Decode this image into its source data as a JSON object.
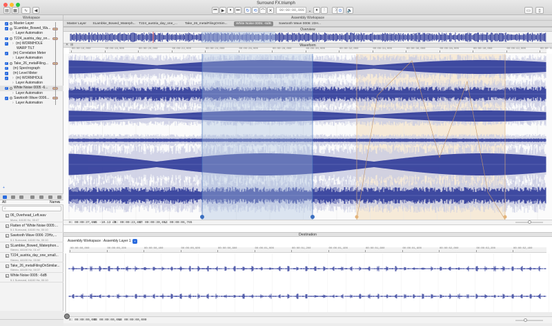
{
  "window": {
    "title": "Surround FX.triumph"
  },
  "transport": {
    "time": "00:00:00,000"
  },
  "left_panel": {
    "header": "Workspace",
    "tree": [
      {
        "label": "Master Layer",
        "level": 0,
        "check": true,
        "icon": true
      },
      {
        "label": "SLambke_Bowed_Wa...",
        "level": 0,
        "check": true,
        "icon": true,
        "slider": true
      },
      {
        "label": "Layer Automation",
        "level": 1,
        "check": false,
        "chev": true
      },
      {
        "label": "T224_austria_day_on...",
        "level": 0,
        "check": true,
        "icon": true,
        "slider": true
      },
      {
        "label": "(m) WORMHOLE",
        "level": 1,
        "check": true,
        "chev": true
      },
      {
        "label": "WARP TILT",
        "level": 2,
        "check": false
      },
      {
        "label": "(m) Correlation Meter",
        "level": 1,
        "check": true
      },
      {
        "label": "Layer Automation",
        "level": 1,
        "check": false,
        "chev": true
      },
      {
        "label": "Take_26_metalFiling...",
        "level": 0,
        "check": true,
        "icon": true,
        "slider": true
      },
      {
        "label": "(m) Spectrograph",
        "level": 1,
        "check": true
      },
      {
        "label": "(m) Level Meter",
        "level": 1,
        "check": true
      },
      {
        "label": "(m) WORMHOLE",
        "level": 1,
        "check": true,
        "chev": true
      },
      {
        "label": "Layer Automation",
        "level": 1,
        "check": false,
        "chev": true
      },
      {
        "label": "White Noise 0005 -6...",
        "level": 0,
        "check": true,
        "icon": true,
        "slider": true,
        "highlight": true
      },
      {
        "label": "Layer Automation",
        "level": 1,
        "check": false,
        "chev": true
      },
      {
        "label": "Sawtooth Wave 0006...",
        "level": 0,
        "check": true,
        "icon": true,
        "slider": true
      },
      {
        "label": "Layer Automation",
        "level": 1,
        "check": false,
        "chev": true
      }
    ],
    "asset_header": {
      "all": "All",
      "name_col": "Name"
    },
    "assets": [
      {
        "name": "06_Overhead_Left.wav",
        "meta": "Mono, 44100 Hz, 00:47"
      },
      {
        "name": "Flatten of \"White Noise 0005:...",
        "meta": "5.1 Surround, 44100 Hz, 00:10"
      },
      {
        "name": "Sawtooth Wave 0006: 23Hz,...",
        "meta": "5.1 Surround, 44100 Hz, 00:10"
      },
      {
        "name": "SLambke_Bowed_Waterphon...",
        "meta": "Stereo, 44100 Hz, 01:47"
      },
      {
        "name": "T224_austria_day_one_small...",
        "meta": "Stereo, 44100 Hz, 00:50"
      },
      {
        "name": "Take_26_metalFilingOnSimilar...",
        "meta": "Stereo, 44100 Hz, 00:37"
      },
      {
        "name": "White Noise 0005: -6dB",
        "meta": "5.1 Surround, 44100 Hz, 00:10"
      }
    ]
  },
  "assembly": {
    "header": "Assembly Workspace"
  },
  "tabs": [
    "Master Layer",
    "SLambke_Bowed_Waterph...",
    "T224_austria_day_one_...",
    "Take_26_metalFilingOrSim...",
    "White Noise 0005: -6dB",
    "Sawtooth Wave 0006: 23H..."
  ],
  "selected_tab": 4,
  "overview": {
    "header": "Overview"
  },
  "waveform": {
    "header": "Waveform",
    "ticks": [
      "00:00:16,000",
      "00:00:18,000",
      "00:00:20,000",
      "00:00:22,000",
      "00:00:24,000",
      "00:00:26,000",
      "00:00:28,000",
      "00:00:30,000",
      "00:00:32,000",
      "00:00:34,000",
      "00:00:36,000",
      "00:00:38,000",
      "00:00:40,000",
      "00:00:42,000",
      "00:00:44,000"
    ],
    "status": {
      "cursor": "H: 00:00:37,685",
      "level": "V: -10.13 dB",
      "start": "S: 00:00:23,887",
      "end": "E: 00:00:30,652",
      "length": "L: 00:00:06,765"
    }
  },
  "destination": {
    "header": "Destination",
    "workspace_label": "Assembly Workspace : Assembly Layer 1",
    "ticks": [
      "00:00:00,000",
      "00:00:00,200",
      "00:00:00,400",
      "00:00:00,600",
      "00:00:00,800",
      "00:00:01,000",
      "00:00:01,200",
      "00:00:01,400",
      "00:00:01,600",
      "00:00:01,800",
      "00:00:02,000",
      "00:00:02,200",
      "00:00:02,400"
    ],
    "status": {
      "start": "S: 00:00:00,000",
      "end": "E: 00:00:00,000",
      "length": "L: 00:00:00,000"
    }
  },
  "colors": {
    "wave": "#2e3a99",
    "wave_light": "#c9cbe3",
    "selection": "#a9bfe0",
    "region": "#f6ead8"
  }
}
